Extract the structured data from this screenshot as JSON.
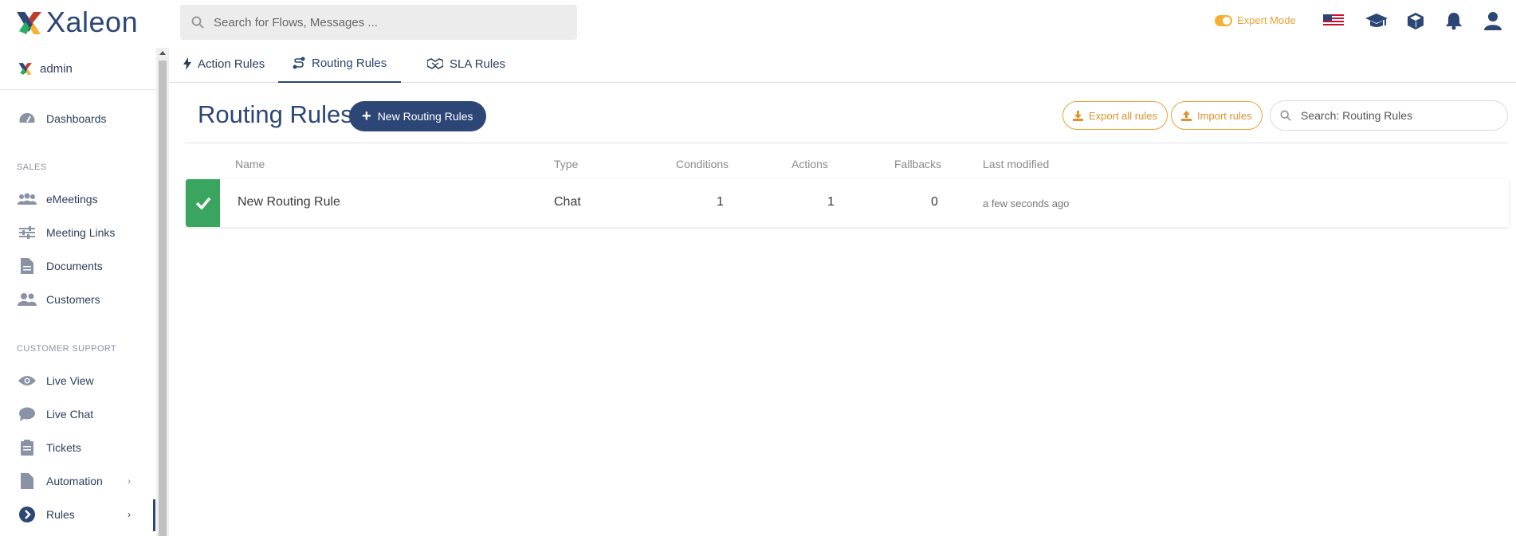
{
  "app": {
    "brand": "Xaleon",
    "search_placeholder": "Search for Flows, Messages ...",
    "expert_mode_label": "Expert Mode",
    "colors": {
      "primary": "#2c4676",
      "accent": "#f5b131",
      "success": "#3aa55e"
    }
  },
  "topbar_icons": [
    "us-flag-icon",
    "graduation-cap-icon",
    "cube-icon",
    "bell-icon",
    "user-icon"
  ],
  "sidebar": {
    "user": "admin",
    "dashboards": "Dashboards",
    "sections": {
      "sales": "SALES",
      "support": "CUSTOMER SUPPORT"
    },
    "sales_items": [
      "eMeetings",
      "Meeting Links",
      "Documents",
      "Customers"
    ],
    "support_items": [
      "Live View",
      "Live Chat",
      "Tickets",
      "Automation",
      "Rules"
    ],
    "chevron": "›"
  },
  "tabs": [
    {
      "label": "Action Rules",
      "active": false
    },
    {
      "label": "Routing Rules",
      "active": true
    },
    {
      "label": "SLA Rules",
      "active": false
    }
  ],
  "main": {
    "title": "Routing Rules",
    "new_button": "New Routing Rules",
    "export_button": "Export all rules",
    "import_button": "Import rules",
    "search_placeholder": "Search: Routing Rules"
  },
  "table": {
    "columns": [
      "Name",
      "Type",
      "Conditions",
      "Actions",
      "Fallbacks",
      "Last modified"
    ],
    "rows": [
      {
        "status": "active",
        "name": "New Routing Rule",
        "type": "Chat",
        "conditions": "1",
        "actions": "1",
        "fallbacks": "0",
        "last_modified": "a few seconds ago"
      }
    ]
  }
}
